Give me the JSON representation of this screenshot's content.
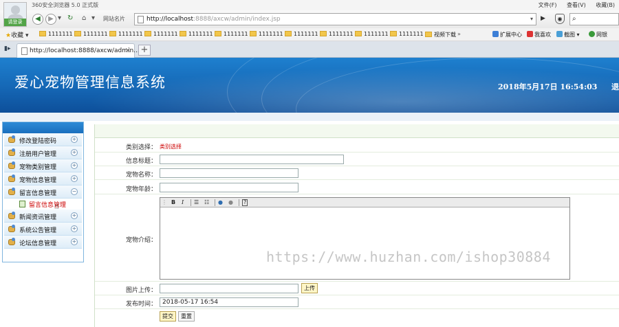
{
  "browser": {
    "app_name": "360安全浏览器 5.0 正式版",
    "menus": [
      "文件(F)",
      "查看(V)",
      "收藏(B)"
    ],
    "login_label": "请登录",
    "site_label": "网站名片",
    "url_host": "http://localhost",
    "url_rest": ":8888/axcw/admin/index.jsp",
    "tab_title": "http://localhost:8888/axcw/admin...",
    "bookmarks_label": "收藏",
    "bookmark_folders": [
      "1111111",
      "1111111",
      "1111111",
      "1111111",
      "1111111",
      "1111111",
      "1111111",
      "1111111",
      "1111111",
      "1111111",
      "1111111",
      "视频下载"
    ],
    "right_tools": [
      "扩展中心",
      "我喜欢",
      "截图",
      "网银"
    ]
  },
  "header": {
    "title": "爱心宠物管理信息系统",
    "datetime": "2018年5月17日  16:54:03",
    "logout_partial": "退"
  },
  "sidebar": {
    "items": [
      {
        "label": "修改登陆密码",
        "toggle": "+"
      },
      {
        "label": "注册用户管理",
        "toggle": "+"
      },
      {
        "label": "宠物类别管理",
        "toggle": "+"
      },
      {
        "label": "宠物信息管理",
        "toggle": "+"
      },
      {
        "label": "留言信息管理",
        "toggle": "−"
      },
      {
        "label": "新闻资讯管理",
        "toggle": "+"
      },
      {
        "label": "系统公告管理",
        "toggle": "+"
      },
      {
        "label": "论坛信息管理",
        "toggle": "+"
      }
    ],
    "sub_item": "留言信息管理"
  },
  "form": {
    "category_label": "类别选择：",
    "category_value": "类别选择",
    "title_label": "信息标题：",
    "name_label": "宠物名称：",
    "age_label": "宠物年龄：",
    "intro_label": "宠物介绍：",
    "upload_label": "图片上传：",
    "upload_button": "上传",
    "publish_label": "发布时间：",
    "publish_value": "2018-05-17 16:54",
    "submit_button": "提交",
    "reset_button": "重置"
  },
  "watermark": "https://www.huzhan.com/ishop30884"
}
